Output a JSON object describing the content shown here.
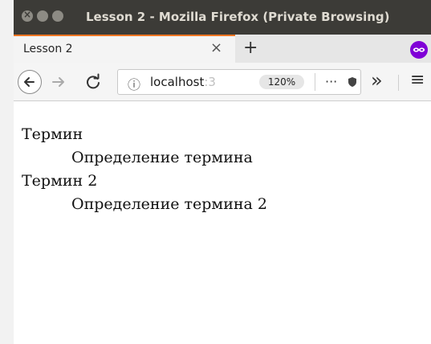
{
  "window": {
    "title": "Lesson 2 - Mozilla Firefox (Private Browsing)"
  },
  "tabs": [
    {
      "label": "Lesson 2",
      "close_glyph": "×"
    }
  ],
  "new_tab_glyph": "+",
  "toolbar": {
    "url_visible": "localhost",
    "url_faded": ":3",
    "zoom": "120%",
    "page_actions_glyph": "···",
    "overflow_glyph": "»",
    "menu_glyph": "≡",
    "info_glyph": "ⓘ"
  },
  "colors": {
    "titlebar": "#3c3b37",
    "tab_accent": "#ee7522",
    "private_purple": "#8000d7"
  },
  "page": {
    "definitions": [
      {
        "term": "Термин",
        "definition": "Определение термина"
      },
      {
        "term": "Термин 2",
        "definition": "Определение термина 2"
      }
    ]
  }
}
